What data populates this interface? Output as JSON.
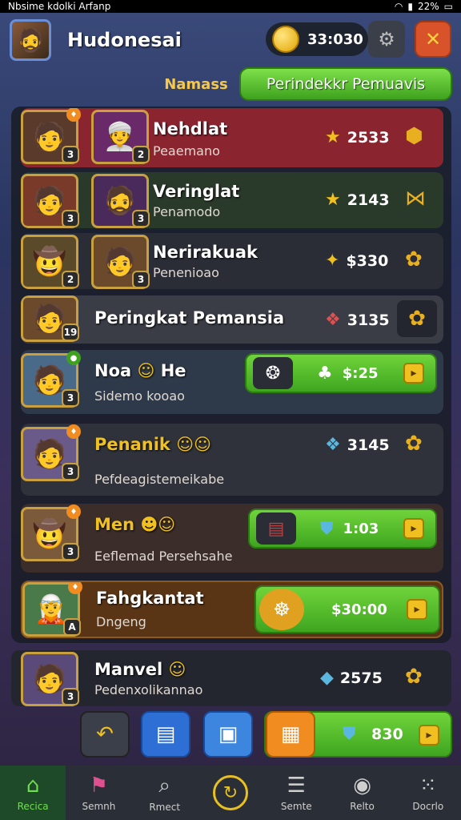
{
  "status": {
    "left": "Nbsime kdolki Arfanp",
    "right": "22%"
  },
  "header": {
    "player_name": "Hudonesai",
    "coins": "33:030",
    "settings_icon": "gear-icon",
    "close_icon": "close-icon"
  },
  "tabs": [
    {
      "label": "Namass"
    },
    {
      "label": "Perindekkr Pemuavis"
    }
  ],
  "rows": [
    {
      "name": "Nehdlat",
      "sub": "Peaemano",
      "score": "2533",
      "lvl1": "3",
      "lvl2": "2",
      "color": "#8a2530"
    },
    {
      "name": "Veringlat",
      "sub": "Penamodo",
      "score": "2143",
      "lvl1": "3",
      "lvl2": "3",
      "color": "#2a3a2a"
    },
    {
      "name": "Nerirakuak",
      "sub": "Penenioao",
      "score": "$330",
      "lvl1": "2",
      "lvl2": "3",
      "color": "#2a2d36"
    },
    {
      "name": "Peringkat Pemansia",
      "sub": "",
      "score": "3135",
      "lvl1": "19",
      "color": "#3a3d46"
    },
    {
      "name": "Noa",
      "name2": "He",
      "sub": "Sidemo kooao",
      "score": "$:25",
      "lvl1": "3",
      "color": "#2e3a4a"
    },
    {
      "name": "Penanik",
      "sub": "Pefdeagistemeikabe",
      "score": "3145",
      "lvl1": "3",
      "color": "#2f323a"
    },
    {
      "name": "Men",
      "sub": "Eeflemad Persehsahe",
      "score": "1:03",
      "lvl1": "3",
      "color": "#3a2d2a"
    },
    {
      "name": "Fahgkantat",
      "sub": "Dngeng",
      "score": "$30:00",
      "lvl1": "A",
      "color": "#5a3515"
    },
    {
      "name": "Manvel",
      "sub": "Pedenxolikannao",
      "score": "2575",
      "lvl1": "3",
      "color": "#23262e"
    }
  ],
  "bottom_actions": {
    "value": "830"
  },
  "nav": [
    {
      "label": "Recica",
      "icon": "home-icon"
    },
    {
      "label": "Semnh",
      "icon": "banner-icon"
    },
    {
      "label": "Rmect",
      "icon": "search-icon"
    },
    {
      "label": "",
      "icon": "center-icon"
    },
    {
      "label": "Semte",
      "icon": "menu-icon"
    },
    {
      "label": "Relto",
      "icon": "character-icon"
    },
    {
      "label": "Docrlo",
      "icon": "dots-icon"
    }
  ]
}
